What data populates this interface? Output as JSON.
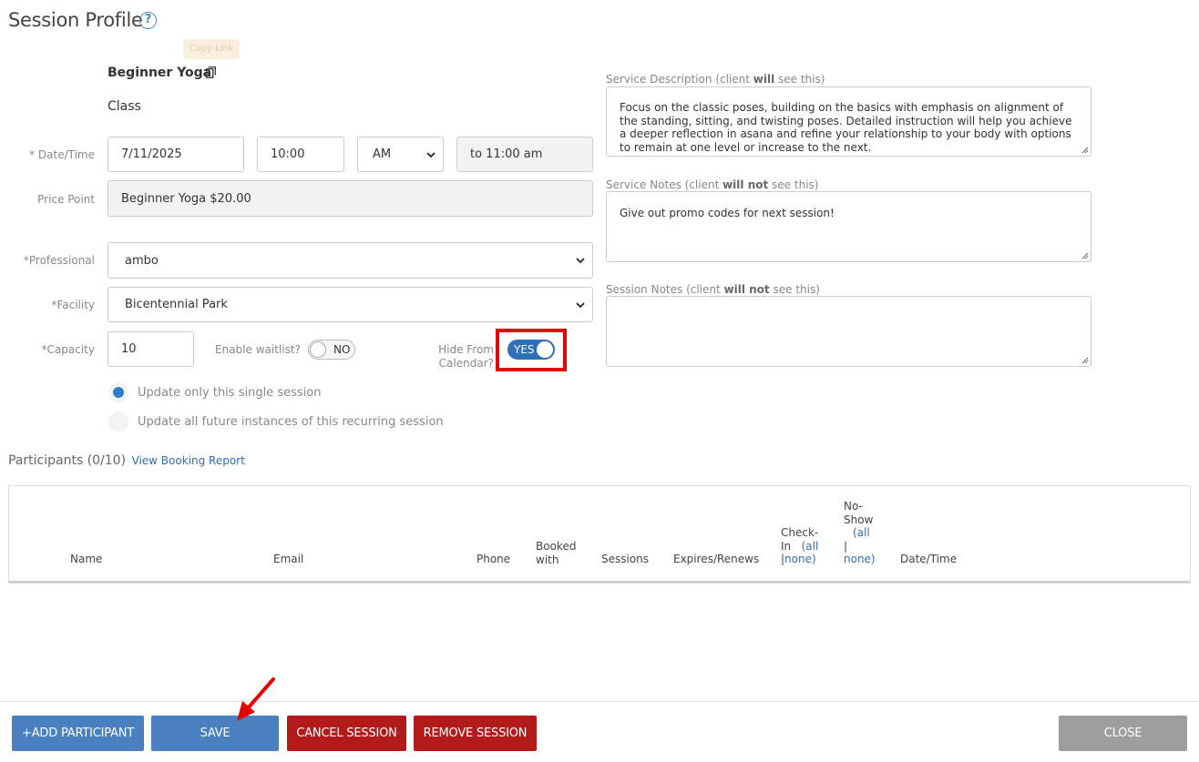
{
  "page": {
    "title": "Session Profile",
    "tooltip": "Copy Link"
  },
  "service": {
    "name": "Beginner Yoga",
    "type": "Class"
  },
  "form": {
    "datetime_label": "* Date/Time",
    "date": "7/11/2025",
    "time": "10:00",
    "ampm": "AM",
    "end_time": "to 11:00 am",
    "price_label": "Price Point",
    "price": "Beginner Yoga $20.00",
    "professional_label": "*Professional",
    "professional": "ambo",
    "facility_label": "*Facility",
    "facility": "Bicentennial Park",
    "capacity_label": "*Capacity",
    "capacity": "10",
    "waitlist_label": "Enable waitlist?",
    "waitlist_value": "NO",
    "hide_label_1": "Hide From",
    "hide_label_2": "Calendar?",
    "hide_value": "YES",
    "radio_single": "Update only this single session",
    "radio_all": "Update all future instances of this recurring session"
  },
  "notes": {
    "desc_label_pre": "Service Description (client ",
    "desc_label_bold": "will",
    "desc_label_post": " see this)",
    "desc_text": "Focus on the classic poses, building on the basics with emphasis on alignment of the standing, sitting, and twisting poses. Detailed instruction will help you achieve a deeper reflection in asana and refine your relationship to your body with options to remain at one level or increase to the next.",
    "svc_notes_label_pre": "Service Notes (client ",
    "svc_notes_label_bold": "will not",
    "svc_notes_label_post": " see this)",
    "svc_notes_text": "Give out promo codes for next session!",
    "session_notes_label_pre": "Session Notes (client ",
    "session_notes_label_bold": "will not",
    "session_notes_label_post": " see this)",
    "session_notes_text": ""
  },
  "participants": {
    "heading": "Participants (0/10)",
    "report_link": "View Booking Report",
    "columns": {
      "name": "Name",
      "email": "Email",
      "phone": "Phone",
      "booked_1": "Booked",
      "booked_2": "with",
      "sessions": "Sessions",
      "expires": "Expires/Renews",
      "checkin_1": "Check-",
      "checkin_2": "In",
      "checkin_all": "(all",
      "checkin_sep": "|",
      "checkin_none": "none)",
      "noshow_1": "No-",
      "noshow_2": "Show",
      "noshow_all": "(all",
      "noshow_sep": "|",
      "noshow_none": "none)",
      "datetime": "Date/Time"
    }
  },
  "footer": {
    "add": "+ADD PARTICIPANT",
    "save": "SAVE",
    "cancel": "CANCEL SESSION",
    "remove": "REMOVE SESSION",
    "close": "CLOSE"
  },
  "colors": {
    "accent": "#2f6fb6",
    "danger": "#b31b1b",
    "highlight": "#e60000"
  }
}
